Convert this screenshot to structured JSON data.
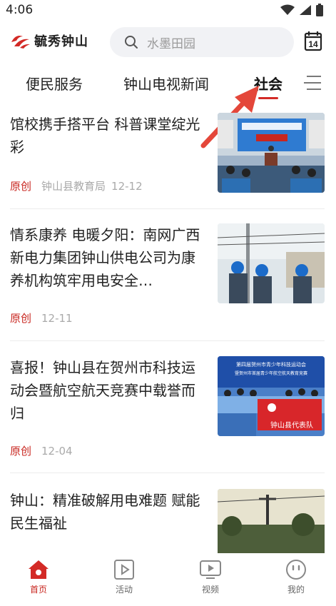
{
  "status_bar": {
    "time": "4:06",
    "icons": [
      "wifi-icon",
      "signal-icon",
      "battery-icon"
    ]
  },
  "header": {
    "logo_text": "毓秀钟山",
    "search_placeholder": "水墨田园",
    "calendar_day": "14"
  },
  "tabs": [
    {
      "label": "便民服务",
      "active": false
    },
    {
      "label": "钟山电视新闻",
      "active": false
    },
    {
      "label": "社会",
      "active": true
    }
  ],
  "news": [
    {
      "title": "馆校携手搭平台 科普课堂绽光彩",
      "tag": "原创",
      "source": "钟山县教育局",
      "date": "12-12"
    },
    {
      "title": "情系康养 电暖夕阳：南网广西新电力集团钟山供电公司为康养机构筑牢用电安全…",
      "tag": "原创",
      "source": "",
      "date": "12-11"
    },
    {
      "title": "喜报！钟山县在贺州市科技运动会暨航空航天竞赛中载誉而归",
      "tag": "原创",
      "source": "",
      "date": "12-04",
      "thumb_text_top": "第四届贺州市青少年科技运动会",
      "thumb_text_mid": "暨贺州市首届青少年航空航天教育竞赛",
      "thumb_banner": "钟山县代表队"
    },
    {
      "title": "钟山：精准破解用电难题 赋能民生福祉",
      "tag": "",
      "source": "",
      "date": ""
    }
  ],
  "bottom_nav": [
    {
      "label": "首页",
      "icon": "home-icon",
      "active": true
    },
    {
      "label": "活动",
      "icon": "play-square-icon",
      "active": false
    },
    {
      "label": "视频",
      "icon": "tv-icon",
      "active": false
    },
    {
      "label": "我的",
      "icon": "smiley-icon",
      "active": false
    }
  ],
  "colors": {
    "accent": "#c8261f",
    "search_bg": "#f1f2f5",
    "muted": "#aaaaaa"
  }
}
